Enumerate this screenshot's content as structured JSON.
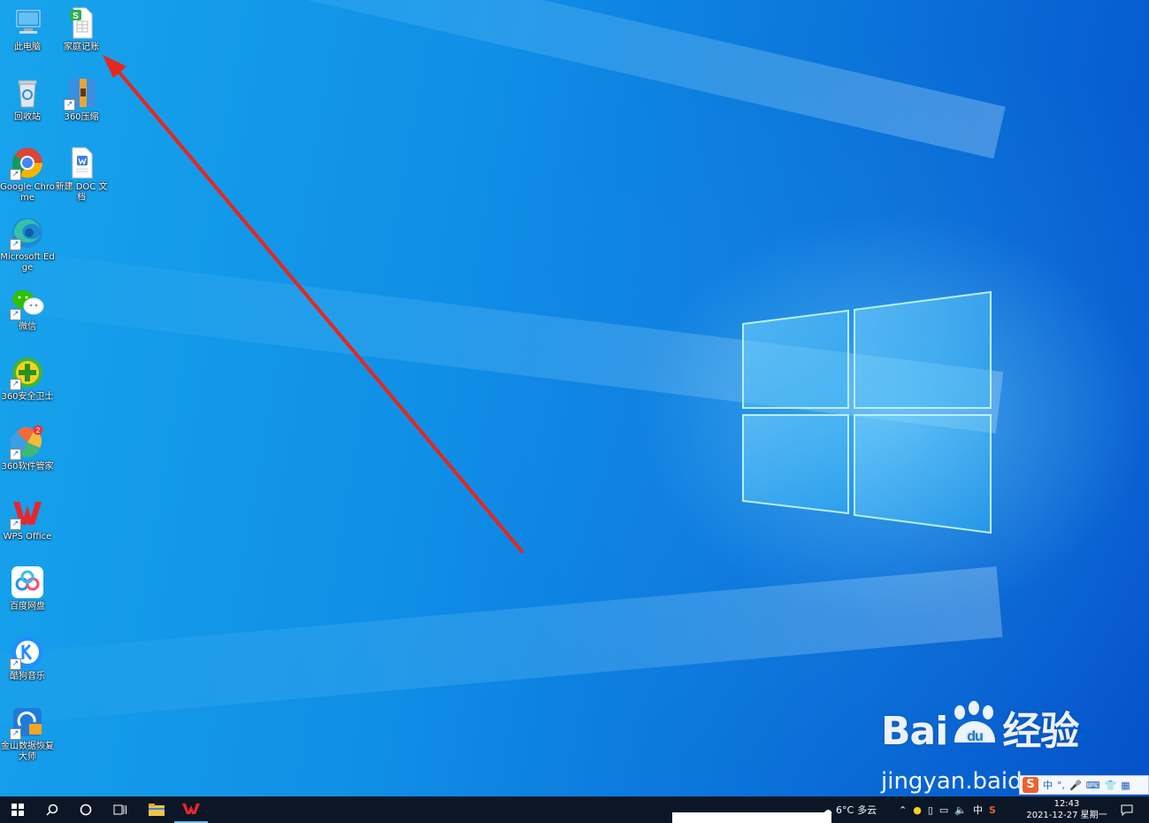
{
  "desktop_icons": [
    {
      "label": "此电脑",
      "icon": "computer-icon"
    },
    {
      "label": "家庭记账",
      "icon": "spreadsheet-file-icon"
    },
    {
      "label": "回收站",
      "icon": "recycle-bin-icon"
    },
    {
      "label": "360压缩",
      "icon": "archive-icon"
    },
    {
      "label": "Google Chrome",
      "icon": "chrome-icon"
    },
    {
      "label": "新建 DOC 文档",
      "icon": "word-document-icon"
    },
    {
      "label": "Microsoft Edge",
      "icon": "edge-icon"
    },
    {
      "label": "微信",
      "icon": "wechat-icon"
    },
    {
      "label": "360安全卫士",
      "icon": "360-security-icon"
    },
    {
      "label": "360软件管家",
      "icon": "360-software-manager-icon"
    },
    {
      "label": "WPS Office",
      "icon": "wps-icon"
    },
    {
      "label": "百度网盘",
      "icon": "baidu-netdisk-icon"
    },
    {
      "label": "酷狗音乐",
      "icon": "kugou-music-icon"
    },
    {
      "label": "金山数据恢复大师",
      "icon": "data-recovery-icon"
    }
  ],
  "badges": {
    "software_manager": "2"
  },
  "spreadsheet_letter": "S",
  "watermark": {
    "brand_left": "Bai",
    "brand_paw_text": "du",
    "brand_right": "经验",
    "url": "jingyan.baidu.com"
  },
  "ime_bar": {
    "logo": "S",
    "mode": "中",
    "punct": "°,",
    "extra": ""
  },
  "taskbar": {
    "weather_temp": "6°C",
    "weather_desc": "多云",
    "ime_mode": "中",
    "time": "12:43",
    "date": "2021-12-27 星期一"
  },
  "colors": {
    "accent": "#76b9ed",
    "taskbar": "#0b1626",
    "arrow": "#e8261c"
  }
}
